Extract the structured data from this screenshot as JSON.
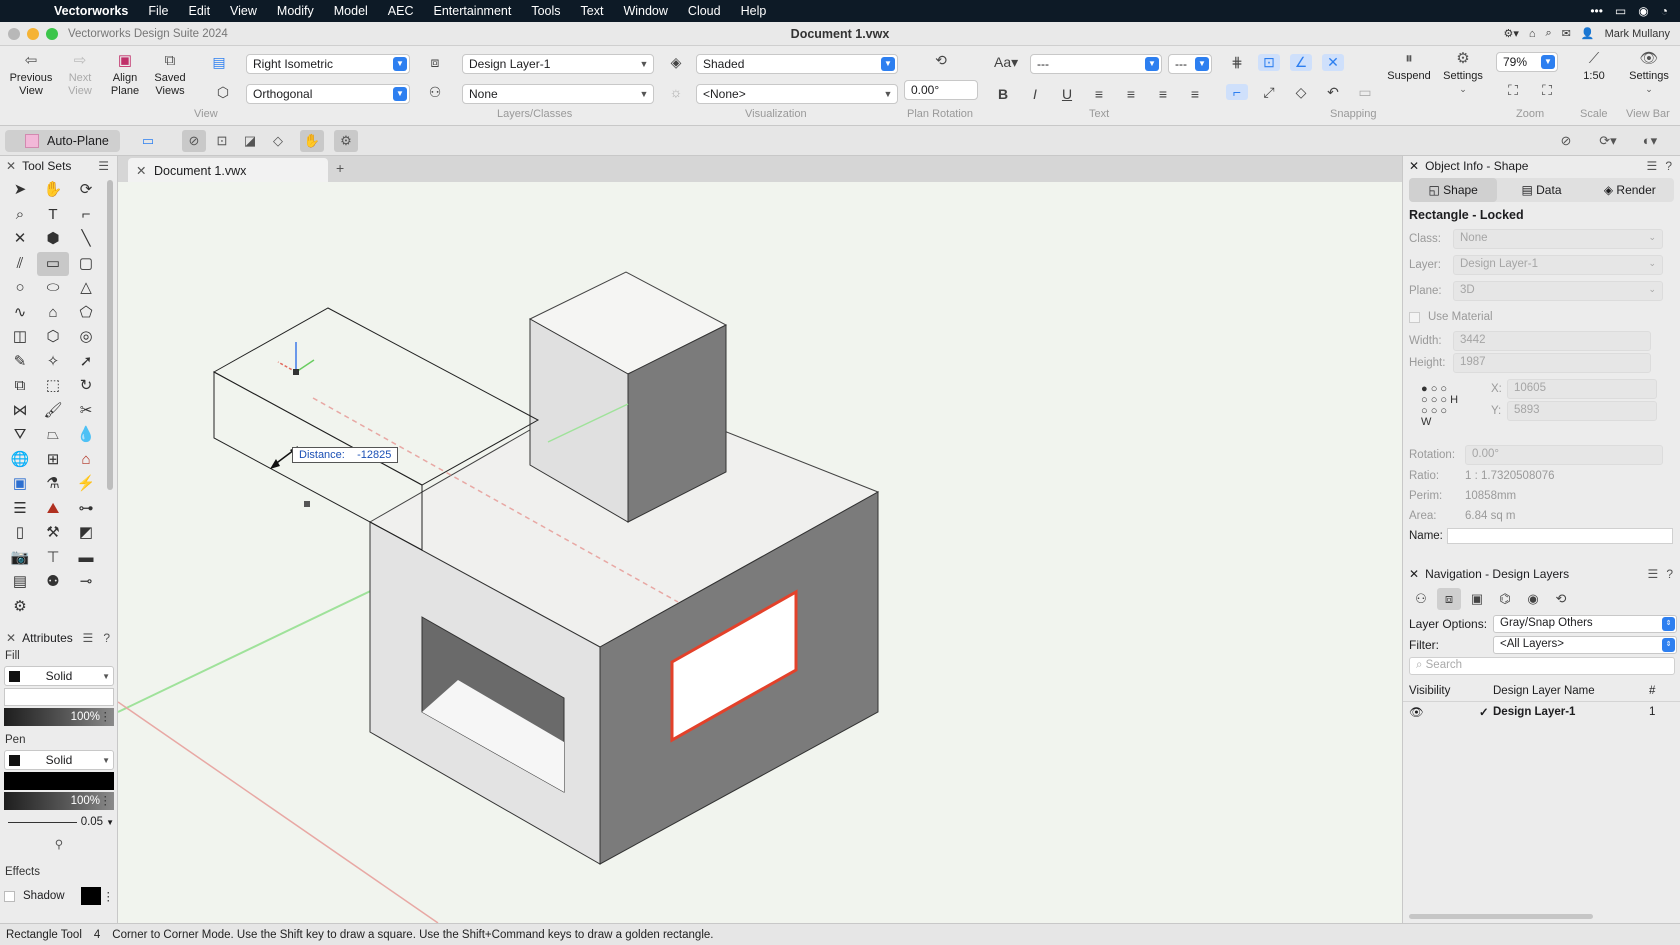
{
  "menubar": {
    "app_name": "Vectorworks",
    "items": [
      "File",
      "Edit",
      "View",
      "Modify",
      "Model",
      "AEC",
      "Entertainment",
      "Tools",
      "Text",
      "Window",
      "Cloud",
      "Help"
    ]
  },
  "titlebar": {
    "app_title": "Vectorworks Design Suite 2024",
    "document_title": "Document 1.vwx",
    "user": "Mark Mullany"
  },
  "toolbar": {
    "previous_view": "Previous View",
    "next_view": "Next View",
    "align_plane": "Align Plane",
    "saved_views": "Saved Views",
    "view_projection": "Right Isometric",
    "view_mode": "Orthogonal",
    "design_layer": "Design Layer-1",
    "class": "None",
    "render_mode": "Shaded",
    "light_none": "<None>",
    "plan_rotation": "0.00°",
    "font_placeholder": "---",
    "font_size_placeholder": "---",
    "suspend": "Suspend",
    "settings": "Settings",
    "zoom": "79%",
    "scale": "1:50",
    "viewbar_settings": "Settings",
    "groups": {
      "view": "View",
      "layers_classes": "Layers/Classes",
      "visualization": "Visualization",
      "plan_rotation": "Plan Rotation",
      "text": "Text",
      "snapping": "Snapping",
      "zoom": "Zoom",
      "scale": "Scale",
      "view_bar": "View Bar"
    }
  },
  "modebar": {
    "auto_plane": "Auto-Plane"
  },
  "tool_sets": {
    "title": "Tool Sets"
  },
  "attributes": {
    "title": "Attributes",
    "fill_label": "Fill",
    "fill_style": "Solid",
    "fill_opacity": "100%",
    "pen_label": "Pen",
    "pen_style": "Solid",
    "pen_opacity": "100%",
    "line_weight": "0.05",
    "effects_label": "Effects",
    "shadow_label": "Shadow"
  },
  "document_tab": {
    "label": "Document 1.vwx"
  },
  "canvas": {
    "distance_label": "Distance:",
    "distance_value": "-12825"
  },
  "object_info": {
    "title": "Object Info - Shape",
    "tabs": [
      "Shape",
      "Data",
      "Render"
    ],
    "object_title": "Rectangle - Locked",
    "class_label": "Class:",
    "class_value": "None",
    "layer_label": "Layer:",
    "layer_value": "Design Layer-1",
    "plane_label": "Plane:",
    "plane_value": "3D",
    "use_material": "Use Material",
    "width_label": "Width:",
    "width_value": "3442",
    "height_label": "Height:",
    "height_value": "1987",
    "x_label": "X:",
    "x_value": "10605",
    "y_label": "Y:",
    "y_value": "5893",
    "h_label": "H",
    "w_label": "W",
    "rotation_label": "Rotation:",
    "rotation_value": "0.00°",
    "ratio_label": "Ratio:",
    "ratio_value": "1 : 1.7320508076",
    "perim_label": "Perim:",
    "perim_value": "10858mm",
    "area_label": "Area:",
    "area_value": "6.84 sq m",
    "name_label": "Name:"
  },
  "navigation": {
    "title": "Navigation - Design Layers",
    "layer_options_label": "Layer Options:",
    "layer_options_value": "Gray/Snap Others",
    "filter_label": "Filter:",
    "filter_value": "<All Layers>",
    "search_placeholder": "Search",
    "col_visibility": "Visibility",
    "col_name": "Design Layer Name",
    "col_number": "#",
    "rows": [
      {
        "name": "Design Layer-1",
        "number": "1"
      }
    ]
  },
  "status": {
    "tool": "Rectangle Tool",
    "shortcut": "4",
    "hint": "Corner to Corner Mode. Use the Shift key to draw a square. Use the Shift+Command keys to draw a golden rectangle."
  }
}
